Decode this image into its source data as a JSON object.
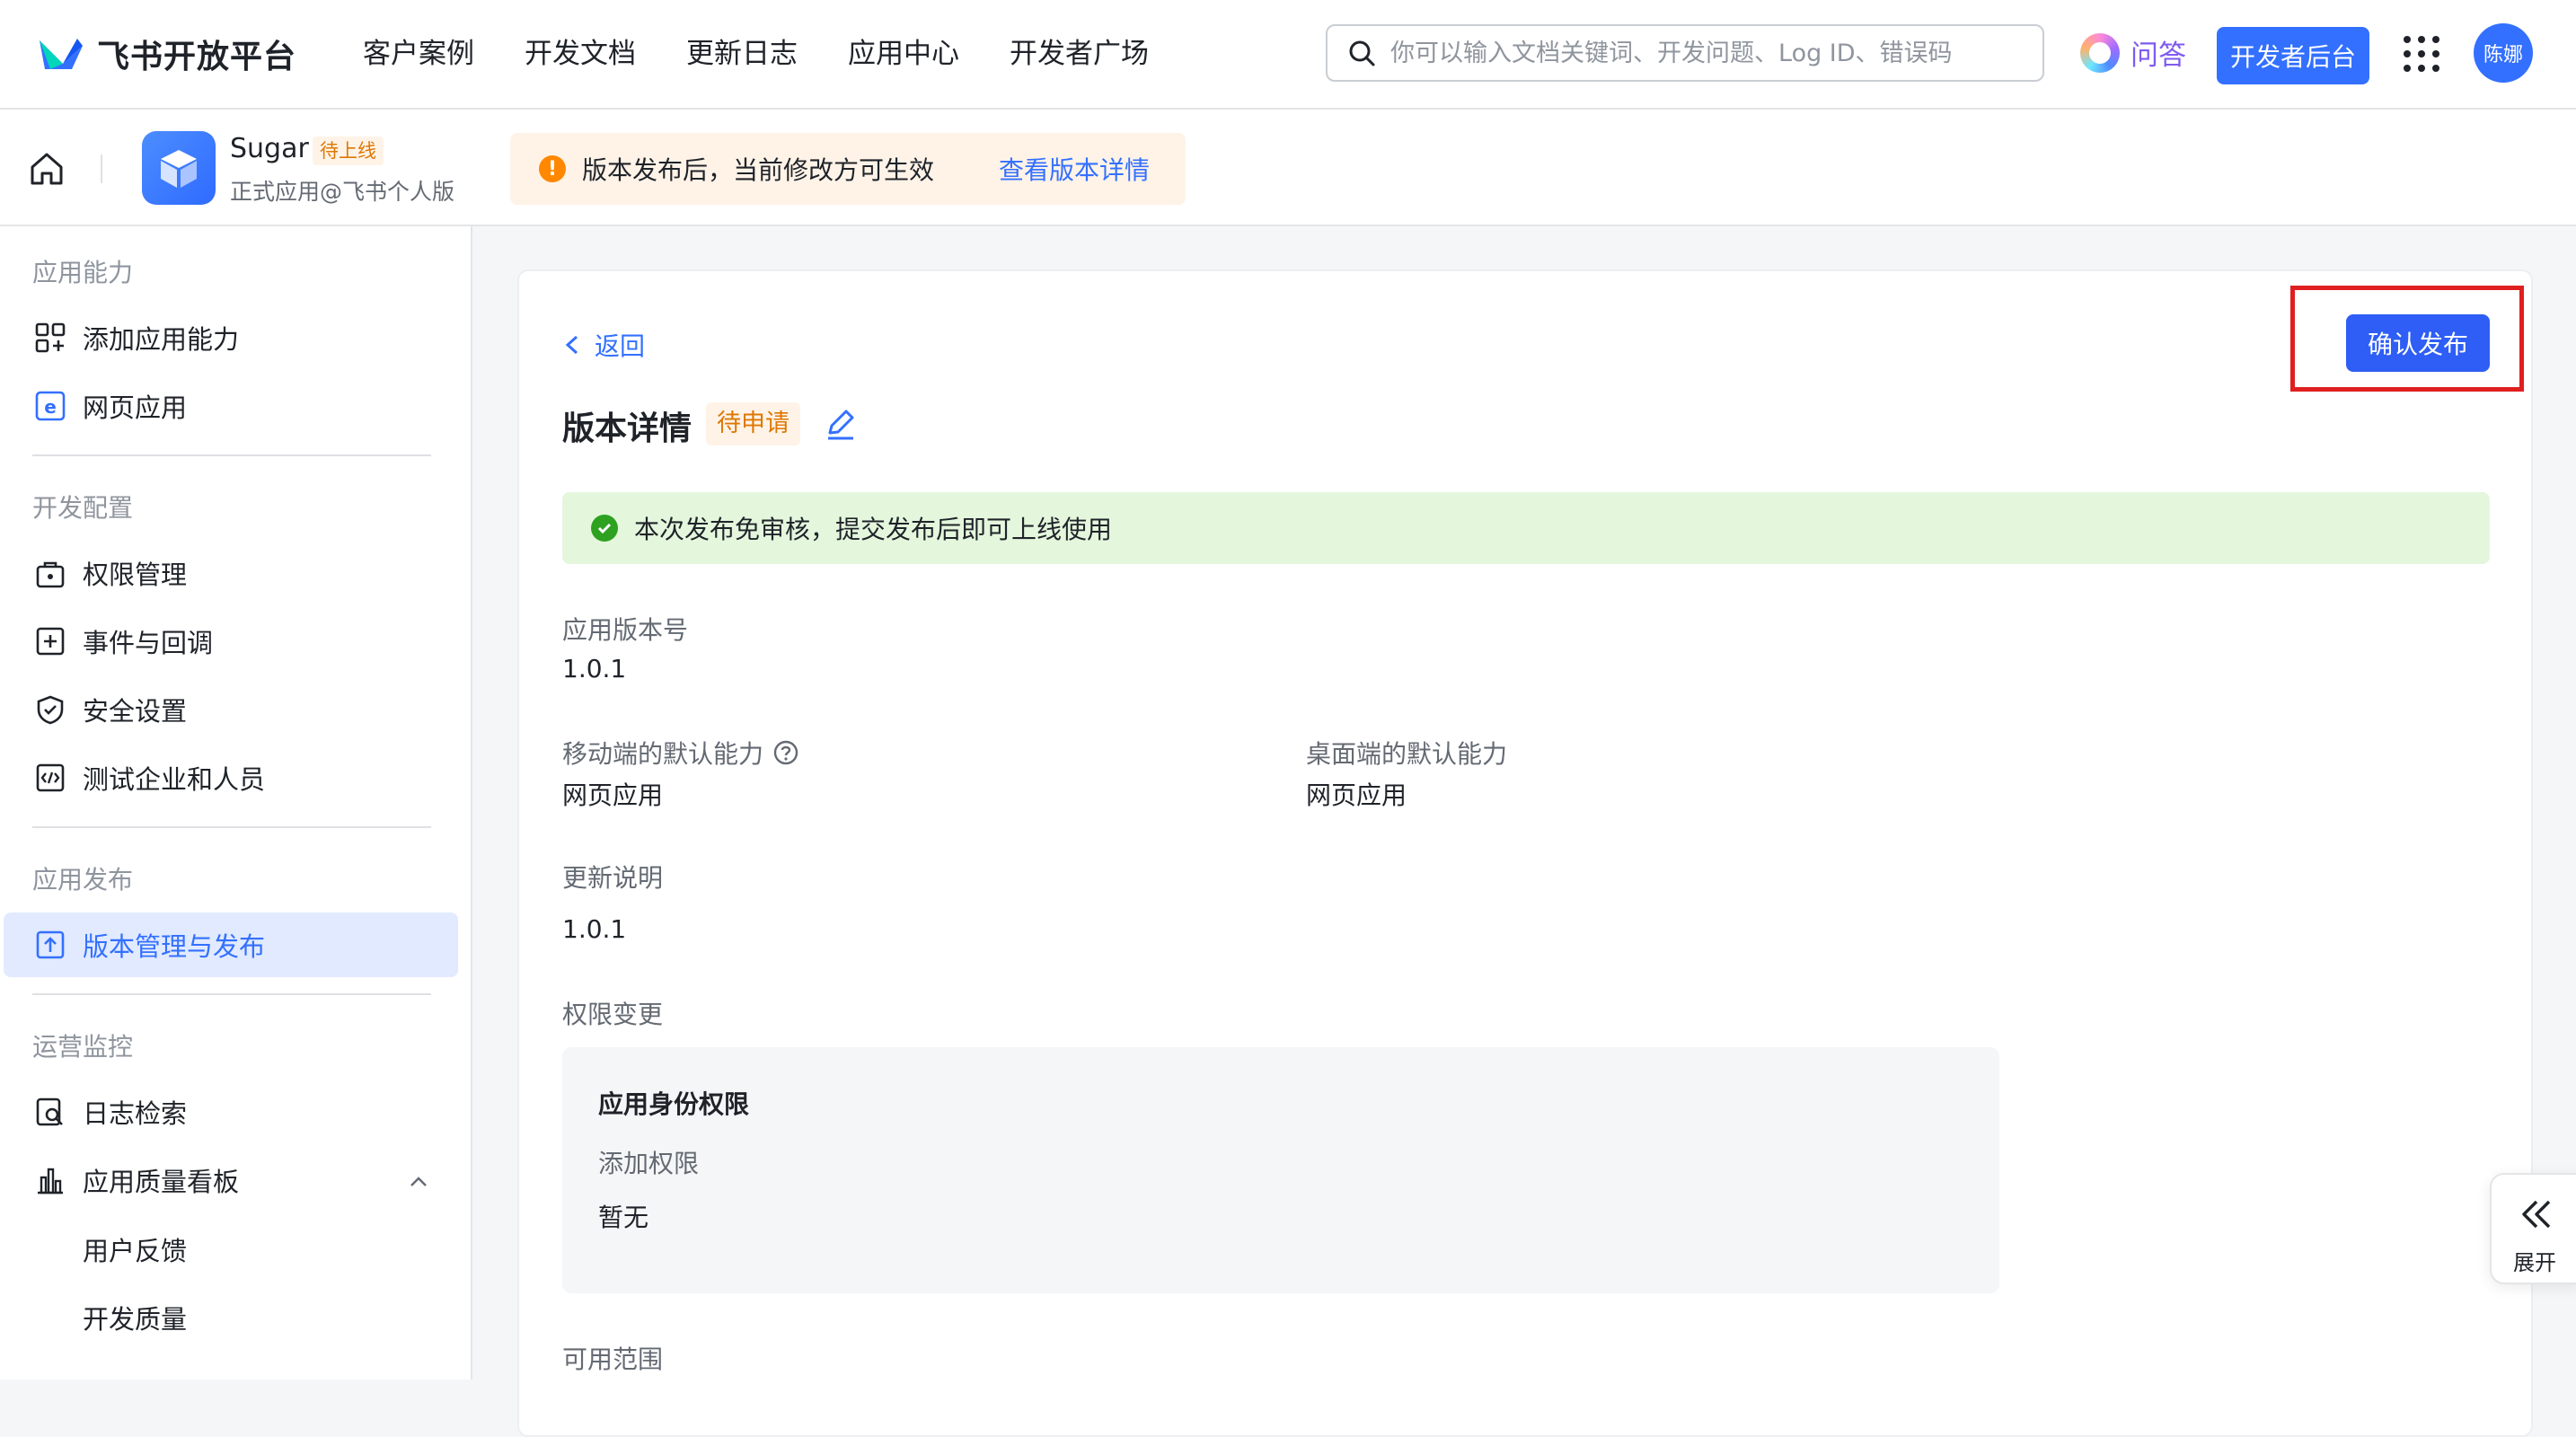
{
  "header": {
    "brand": "飞书开放平台",
    "nav": [
      "客户案例",
      "开发文档",
      "更新日志",
      "应用中心",
      "开发者广场"
    ],
    "search_placeholder": "你可以输入文档关键词、开发问题、Log ID、错误码",
    "qa_label": "问答",
    "dev_console_label": "开发者后台",
    "avatar_text": "陈娜"
  },
  "app": {
    "name": "Sugar",
    "status": "待上线",
    "subtitle": "正式应用@飞书个人版"
  },
  "notice": {
    "text": "版本发布后，当前修改方可生效",
    "link": "查看版本详情"
  },
  "sidebar": {
    "sections": [
      {
        "title": "应用能力",
        "items": [
          "添加应用能力",
          "网页应用"
        ]
      },
      {
        "title": "开发配置",
        "items": [
          "权限管理",
          "事件与回调",
          "安全设置",
          "测试企业和人员"
        ]
      },
      {
        "title": "应用发布",
        "items": [
          "版本管理与发布"
        ]
      },
      {
        "title": "运营监控",
        "items": [
          "日志检索",
          "应用质量看板"
        ],
        "subitems": [
          "用户反馈",
          "开发质量"
        ]
      }
    ],
    "active_item": "版本管理与发布"
  },
  "main": {
    "back_label": "返回",
    "confirm_label": "确认发布",
    "title": "版本详情",
    "title_badge": "待申请",
    "success_text": "本次发布免审核，提交发布后即可上线使用",
    "fields": {
      "version_label": "应用版本号",
      "version_value": "1.0.1",
      "mobile_label": "移动端的默认能力",
      "mobile_value": "网页应用",
      "desktop_label": "桌面端的默认能力",
      "desktop_value": "网页应用",
      "notes_label": "更新说明",
      "notes_value": "1.0.1",
      "perm_label": "权限变更",
      "perm_title": "应用身份权限",
      "perm_add_label": "添加权限",
      "perm_add_value": "暂无",
      "scope_label": "可用范围"
    }
  },
  "expand_label": "展开",
  "colors": {
    "primary": "#3370ff",
    "confirm": "#2e5ef5",
    "highlight_border": "#e02020",
    "success_bg": "#e4f7dd",
    "notice_bg": "#fff3e8",
    "badge_orange": "#de7802"
  },
  "icons": [
    "logo-icon",
    "search-icon",
    "qa-icon",
    "grid-icon",
    "home-icon",
    "app-cube-icon",
    "warning-icon",
    "add-app-icon",
    "web-app-icon",
    "permission-icon",
    "event-icon",
    "shield-icon",
    "test-icon",
    "upload-icon",
    "log-search-icon",
    "chart-icon",
    "chevron-up-icon",
    "chevron-left-icon",
    "edit-icon",
    "check-circle-icon",
    "help-icon",
    "double-chevron-left-icon"
  ]
}
